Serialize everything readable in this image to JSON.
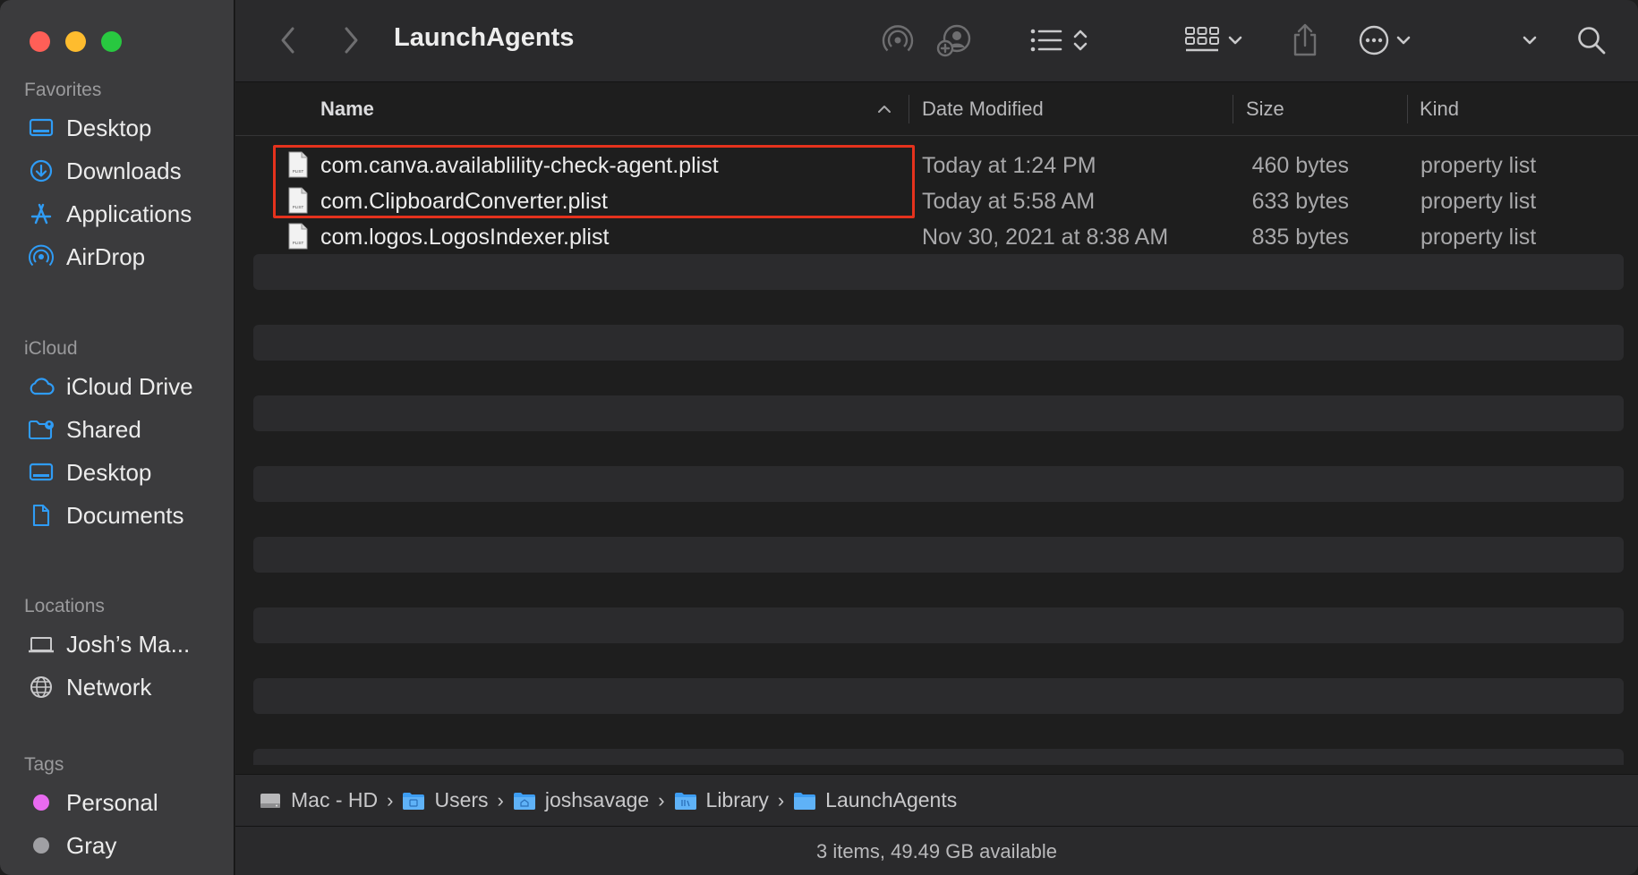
{
  "window": {
    "title": "LaunchAgents"
  },
  "sidebar": {
    "favorites_heading": "Favorites",
    "favorites": [
      {
        "label": "Desktop",
        "icon": "desktop-icon"
      },
      {
        "label": "Downloads",
        "icon": "downloads-icon"
      },
      {
        "label": "Applications",
        "icon": "applications-icon"
      },
      {
        "label": "AirDrop",
        "icon": "airdrop-icon"
      }
    ],
    "icloud_heading": "iCloud",
    "icloud": [
      {
        "label": "iCloud Drive",
        "icon": "icloud-icon"
      },
      {
        "label": "Shared",
        "icon": "shared-folder-icon"
      },
      {
        "label": "Desktop",
        "icon": "desktop-icon"
      },
      {
        "label": "Documents",
        "icon": "document-icon"
      }
    ],
    "locations_heading": "Locations",
    "locations": [
      {
        "label": "Josh’s Ma...",
        "icon": "laptop-icon"
      },
      {
        "label": "Network",
        "icon": "globe-icon"
      }
    ],
    "tags_heading": "Tags",
    "tags": [
      {
        "label": "Personal",
        "color": "#e86af0"
      },
      {
        "label": "Gray",
        "color": "#a0a0a4"
      }
    ]
  },
  "columns": {
    "name": "Name",
    "date": "Date Modified",
    "size": "Size",
    "kind": "Kind"
  },
  "files": [
    {
      "name": "com.canva.availablility-check-agent.plist",
      "date": "Today at 1:24 PM",
      "size": "460 bytes",
      "kind": "property list"
    },
    {
      "name": "com.ClipboardConverter.plist",
      "date": "Today at 5:58 AM",
      "size": "633 bytes",
      "kind": "property list"
    },
    {
      "name": "com.logos.LogosIndexer.plist",
      "date": "Nov 30, 2021 at 8:38 AM",
      "size": "835 bytes",
      "kind": "property list"
    }
  ],
  "file_icon_label": "PLIST",
  "path": [
    {
      "label": "Mac - HD",
      "icon": "hard-drive-icon"
    },
    {
      "label": "Users",
      "icon": "folder-icon"
    },
    {
      "label": "joshsavage",
      "icon": "home-folder-icon"
    },
    {
      "label": "Library",
      "icon": "folder-icon"
    },
    {
      "label": "LaunchAgents",
      "icon": "folder-icon"
    }
  ],
  "status": "3 items, 49.49 GB available",
  "colors": {
    "accent": "#2f9cf6",
    "highlight_box": "#e5321d"
  }
}
